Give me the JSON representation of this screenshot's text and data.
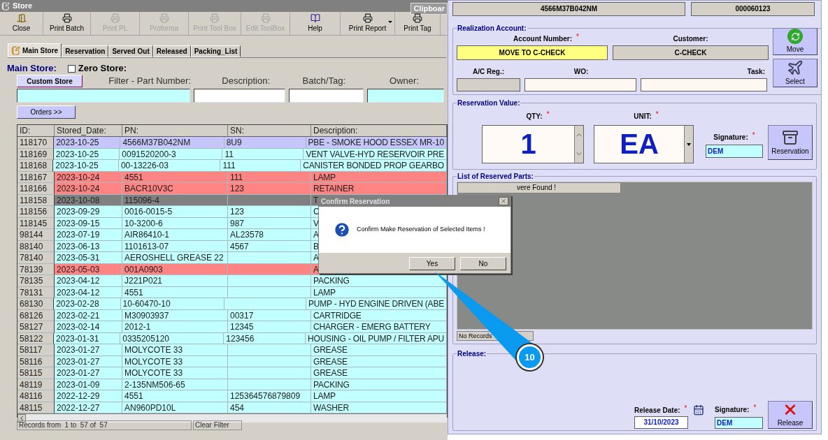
{
  "window": {
    "title": "Store",
    "side_tab": "Clipboar"
  },
  "toolbar": [
    {
      "label": "Close",
      "kind": "exit",
      "disabled": false,
      "menu": false
    },
    {
      "label": "Print Batch",
      "kind": "print",
      "disabled": false,
      "menu": false
    },
    {
      "label": "Print PL",
      "kind": "print",
      "disabled": true,
      "menu": false
    },
    {
      "label": "Proforma",
      "kind": "print",
      "disabled": true,
      "menu": false
    },
    {
      "label": "Print Tool Box",
      "kind": "print",
      "disabled": true,
      "menu": false
    },
    {
      "label": "Edit ToolBox",
      "kind": "print",
      "disabled": true,
      "menu": false
    },
    {
      "label": "Help",
      "kind": "help",
      "disabled": false,
      "menu": false
    },
    {
      "label": "Print Report",
      "kind": "print",
      "disabled": false,
      "menu": true
    },
    {
      "label": "Print Tag",
      "kind": "print",
      "disabled": false,
      "menu": false
    }
  ],
  "tabs": [
    {
      "label": "Main Store",
      "selected": true
    },
    {
      "label": "Reservation",
      "selected": false
    },
    {
      "label": "Served Out",
      "selected": false
    },
    {
      "label": "Released",
      "selected": false
    },
    {
      "label": "Packing_List",
      "selected": false
    }
  ],
  "filter": {
    "group_title": "Main Store:",
    "zero_store": {
      "label": "Zero Store:",
      "checked": false
    },
    "custom_store_button": "Custom Store",
    "fields": [
      {
        "label": "Filter - Part Number:",
        "highlighted": true
      },
      {
        "label": "Description:",
        "highlighted": false
      },
      {
        "label": "Batch/Tag:",
        "highlighted": false
      },
      {
        "label": "Owner:",
        "highlighted": true
      }
    ],
    "orders_button": "Orders >>"
  },
  "table": {
    "columns": [
      "ID:",
      "Stored_Date:",
      "PN:",
      "SN:",
      "Description:"
    ],
    "rows": [
      {
        "kind": "selected",
        "cells": [
          "118170",
          "2023-10-25",
          "4566M37B042NM",
          "8U9",
          "PBE - SMOKE HOOD ESSEX MR-10"
        ]
      },
      {
        "kind": "normal",
        "cells": [
          "118169",
          "2023-10-25",
          "0091520200-3",
          "11",
          "VENT VALVE-HYD RESERVOIR PRE"
        ]
      },
      {
        "kind": "normal",
        "cells": [
          "118168",
          "2023-10-25",
          "00-13226-03",
          "111",
          "CANISTER BONDED PROP GEARBO"
        ]
      },
      {
        "kind": "flagged",
        "cells": [
          "118167",
          "2023-10-24",
          "4551",
          "111",
          "LAMP"
        ]
      },
      {
        "kind": "flagged",
        "cells": [
          "118166",
          "2023-10-24",
          "BACR10V3C",
          "123",
          "RETAINER"
        ]
      },
      {
        "kind": "inactive",
        "cells": [
          "118158",
          "2023-10-08",
          "115096-4",
          "",
          "T"
        ]
      },
      {
        "kind": "normal",
        "cells": [
          "118156",
          "2023-09-29",
          "0016-0015-5",
          "123",
          "C"
        ]
      },
      {
        "kind": "normal",
        "cells": [
          "118145",
          "2023-09-15",
          "10-3200-6",
          "987",
          "V"
        ]
      },
      {
        "kind": "normal",
        "cells": [
          "98144",
          "2023-07-19",
          "AIR86410-1",
          "AL23578",
          "A"
        ]
      },
      {
        "kind": "normal",
        "cells": [
          "88140",
          "2023-06-13",
          "1101613-07",
          "4567",
          "B"
        ]
      },
      {
        "kind": "normal",
        "cells": [
          "78140",
          "2023-05-31",
          "AEROSHELL GREASE 22",
          "",
          "A"
        ]
      },
      {
        "kind": "flagged",
        "cells": [
          "78139",
          "2023-05-03",
          "001A0903",
          "",
          "A"
        ]
      },
      {
        "kind": "normal",
        "cells": [
          "78135",
          "2023-04-12",
          "J221P021",
          "",
          "PACKING"
        ]
      },
      {
        "kind": "normal",
        "cells": [
          "78131",
          "2023-04-12",
          "4551",
          "",
          "LAMP"
        ]
      },
      {
        "kind": "normal",
        "cells": [
          "68130",
          "2023-02-28",
          "10-60470-10",
          "",
          "PUMP - HYD ENGINE DRIVEN (ABE"
        ]
      },
      {
        "kind": "normal",
        "cells": [
          "68126",
          "2023-02-21",
          "M30903937",
          "00317",
          "CARTRIDGE"
        ]
      },
      {
        "kind": "normal",
        "cells": [
          "58127",
          "2023-02-14",
          "2012-1",
          "12345",
          "CHARGER - EMERG BATTERY"
        ]
      },
      {
        "kind": "normal",
        "cells": [
          "58122",
          "2023-01-31",
          "0335205120",
          "123456",
          "HOUSING - OIL PUMP / FILTER APU"
        ]
      },
      {
        "kind": "normal",
        "cells": [
          "58117",
          "2023-01-27",
          "MOLYCOTE 33",
          "",
          "GREASE"
        ]
      },
      {
        "kind": "normal",
        "cells": [
          "58116",
          "2023-01-27",
          "MOLYCOTE 33",
          "",
          "GREASE"
        ]
      },
      {
        "kind": "normal",
        "cells": [
          "58115",
          "2023-01-27",
          "MOLYCOTE 33",
          "",
          "GREASE"
        ]
      },
      {
        "kind": "normal",
        "cells": [
          "48119",
          "2023-01-09",
          "2-135NM506-65",
          "",
          "PACKING"
        ]
      },
      {
        "kind": "normal",
        "cells": [
          "48116",
          "2022-12-29",
          "4551",
          "125364576879809",
          "LAMP"
        ]
      },
      {
        "kind": "normal",
        "cells": [
          "48115",
          "2022-12-27",
          "AN960PD10L",
          "454",
          "WASHER"
        ]
      }
    ]
  },
  "status_bar": {
    "records": "Records from  1 to  57 of  57",
    "clear_filter": "Clear Filter"
  },
  "dialog": {
    "title": "Confirm Reservation",
    "message": "Confirm Make Reservation of Selected Items !",
    "buttons": [
      "Yes",
      "No"
    ]
  },
  "callout": {
    "label": "10"
  },
  "panel": {
    "top_fields": [
      "4566M37B042NM",
      "000060123"
    ],
    "realization": {
      "title": "Realization Account:",
      "account_label": {
        "text": "Account Number:",
        "mark": "*"
      },
      "account_value": "MOVE TO C-CHECK",
      "customer_label": "Customer:",
      "customer_value": "C-CHECK",
      "move_button": "Move",
      "ac_reg_label": "A/C Reg.:",
      "wo_label": "WO:",
      "task_label": "Task:",
      "select_button": "Select"
    },
    "reservation": {
      "title": "Reservation Value:",
      "qty_label": {
        "text": "QTY:",
        "mark": "*"
      },
      "qty_value": "1",
      "unit_label": {
        "text": "UNIT:",
        "mark": "*"
      },
      "unit_value": "EA",
      "signature_label": {
        "text": "Signature:",
        "mark": "*"
      },
      "signature_value": "DEM",
      "button": "Reservation"
    },
    "reserved_parts": {
      "title": "List of Reserved Parts:",
      "header": "vere Found !",
      "footer": "No Records"
    },
    "release": {
      "title": "Release:",
      "date_label": {
        "text": "Release Date:",
        "mark": "*"
      },
      "date_value": "31/10/2023",
      "signature_label": {
        "text": "Signature:",
        "mark": "*"
      },
      "signature_value": "DEM",
      "button": "Release"
    }
  }
}
